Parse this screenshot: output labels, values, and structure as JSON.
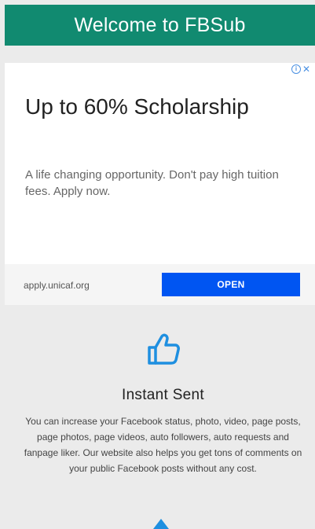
{
  "header": {
    "title": "Welcome to FBSub"
  },
  "ad": {
    "info_icon": "info-icon",
    "close_icon": "close-icon",
    "close_glyph": "✕",
    "info_glyph": "i",
    "headline": "Up to 60% Scholarship",
    "description": "A life changing opportunity. Don't pay high tuition fees. Apply now.",
    "url": "apply.unicaf.org",
    "open_label": "OPEN",
    "button_color": "#0055f2"
  },
  "feature": {
    "icon": "thumbs-up-icon",
    "title": "Instant Sent",
    "description": "You can increase your Facebook status, photo, video, page posts, page photos, page videos, auto followers, auto requests and fanpage liker. Our website also helps you get tons of comments on your public Facebook posts without any cost."
  },
  "colors": {
    "header": "#118a70",
    "accent": "#1e8fe0",
    "background": "#ebebeb"
  }
}
